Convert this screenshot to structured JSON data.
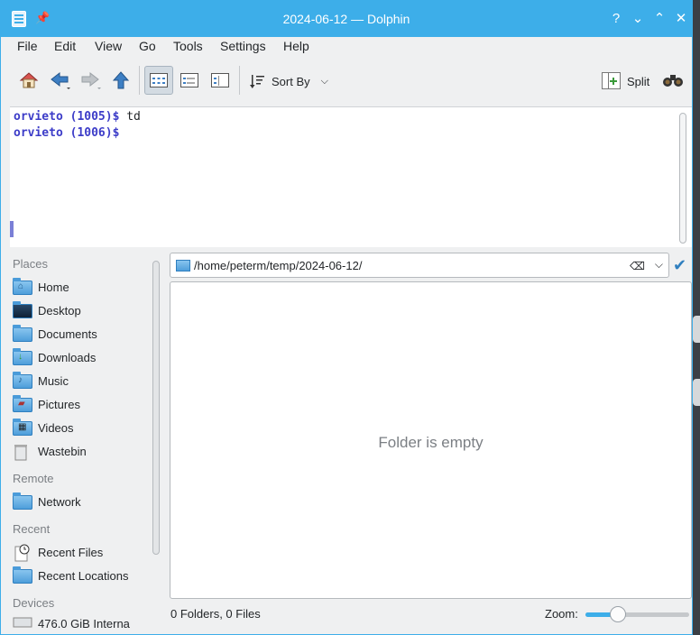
{
  "window": {
    "title": "2024-06-12 — Dolphin"
  },
  "titlebar_buttons": [
    "?",
    "⌄",
    "⌃",
    "✕"
  ],
  "menu": [
    "File",
    "Edit",
    "View",
    "Go",
    "Tools",
    "Settings",
    "Help"
  ],
  "toolbar": {
    "sort_label": "Sort By",
    "split_label": "Split"
  },
  "terminal": {
    "lines": [
      {
        "prompt": "orvieto (1005)$",
        "command": " td"
      },
      {
        "prompt": "orvieto (1006)$",
        "command": ""
      }
    ]
  },
  "places": {
    "sections": [
      "Places",
      "Remote",
      "Recent",
      "Devices"
    ],
    "items": [
      {
        "label": "Home",
        "icon": "home-folder-icon"
      },
      {
        "label": "Desktop",
        "icon": "desktop-folder-icon"
      },
      {
        "label": "Documents",
        "icon": "documents-folder-icon"
      },
      {
        "label": "Downloads",
        "icon": "downloads-folder-icon"
      },
      {
        "label": "Music",
        "icon": "music-folder-icon"
      },
      {
        "label": "Pictures",
        "icon": "pictures-folder-icon"
      },
      {
        "label": "Videos",
        "icon": "videos-folder-icon"
      },
      {
        "label": "Wastebin",
        "icon": "wastebin-icon"
      },
      {
        "label": "Network",
        "icon": "network-folder-icon"
      },
      {
        "label": "Recent Files",
        "icon": "recent-files-icon"
      },
      {
        "label": "Recent Locations",
        "icon": "recent-locations-icon"
      },
      {
        "label": "476.0 GiB Interna",
        "icon": "drive-icon"
      }
    ]
  },
  "location": {
    "path": "/home/peterm/temp/2024-06-12/"
  },
  "view": {
    "empty_text": "Folder is empty"
  },
  "status": {
    "summary": "0 Folders, 0 Files",
    "zoom_label": "Zoom:",
    "zoom_level": 0.28
  },
  "colors": {
    "accent": "#3daee9",
    "prompt": "#3c3cc8"
  }
}
